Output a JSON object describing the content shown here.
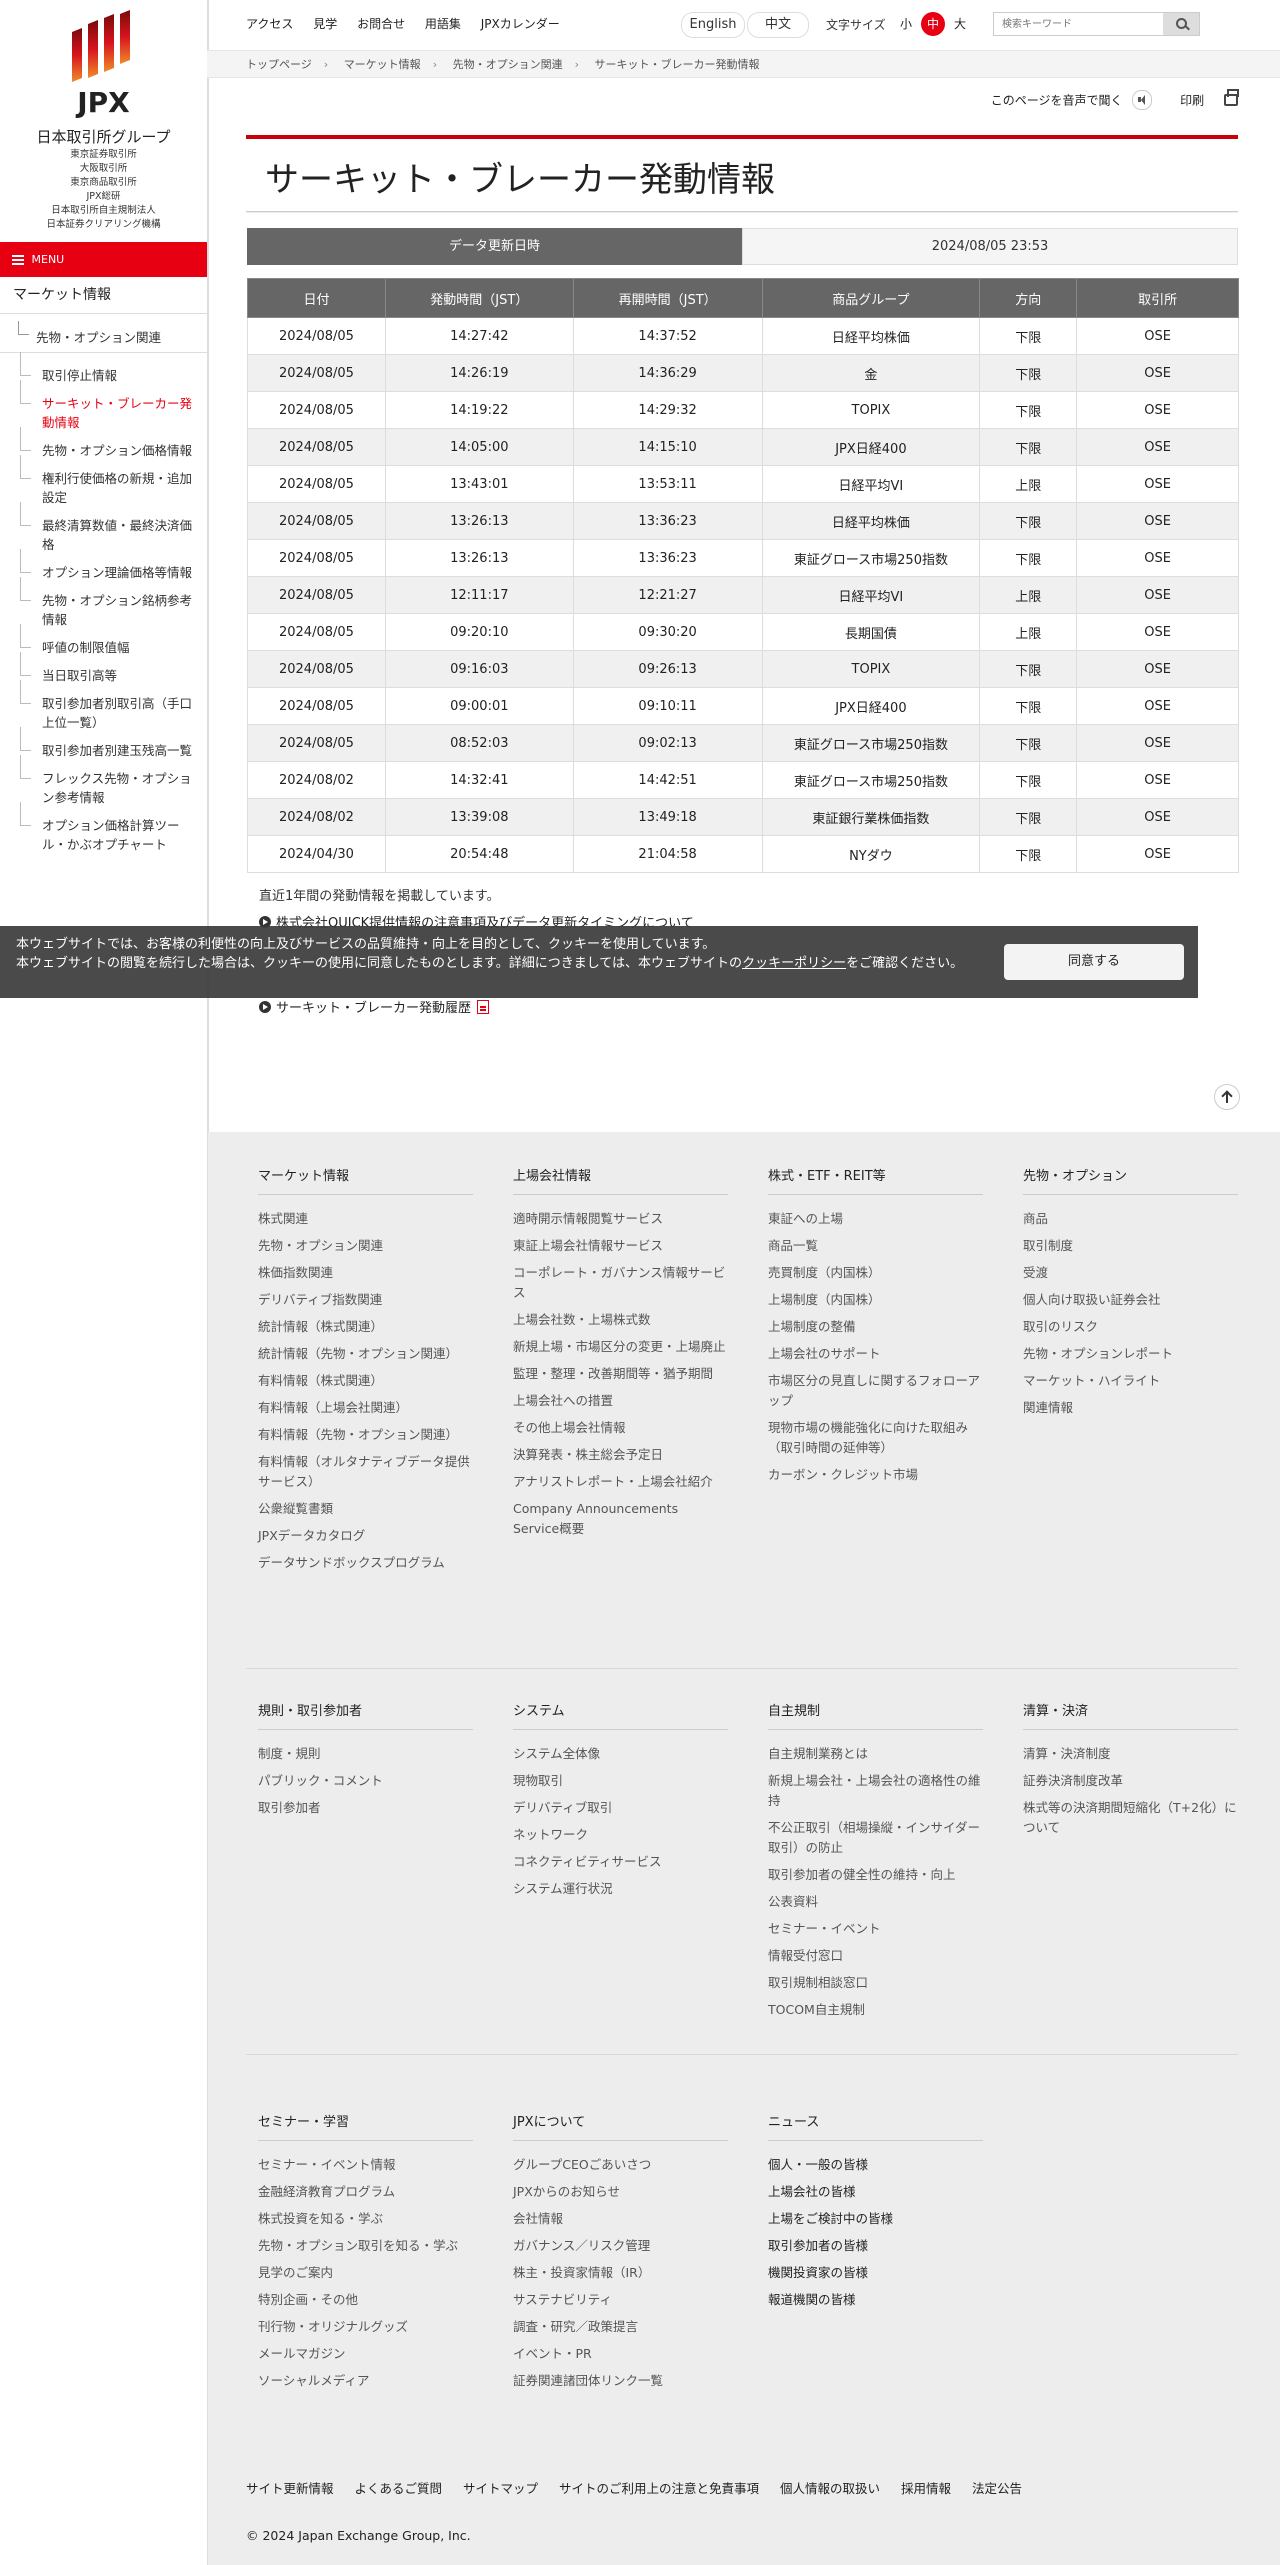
{
  "logo": {
    "brand": "JPX",
    "group_name": "日本取引所グループ",
    "subsidiaries": [
      "東京証券取引所",
      "大阪取引所",
      "東京商品取引所",
      "JPX総研",
      "日本取引所自主規制法人",
      "日本証券クリアリング機構"
    ]
  },
  "menu_label": "MENU",
  "sidebar": {
    "top": "マーケット情報",
    "sub": "先物・オプション関連",
    "items": [
      {
        "label": "取引停止情報",
        "active": false
      },
      {
        "label": "サーキット・ブレーカー発動情報",
        "active": true
      },
      {
        "label": "先物・オプション価格情報",
        "active": false
      },
      {
        "label": "権利行使価格の新規・追加設定",
        "active": false
      },
      {
        "label": "最終清算数値・最終決済価格",
        "active": false
      },
      {
        "label": "オプション理論価格等情報",
        "active": false
      },
      {
        "label": "先物・オプション銘柄参考情報",
        "active": false
      },
      {
        "label": "呼値の制限值幅",
        "active": false
      },
      {
        "label": "当日取引高等",
        "active": false
      },
      {
        "label": "取引参加者別取引高（手口上位一覧）",
        "active": false
      },
      {
        "label": "取引参加者別建玉残高一覧",
        "active": false
      },
      {
        "label": "フレックス先物・オプション参考情報",
        "active": false
      },
      {
        "label": "オプション価格計算ツール・かぶオプチャート",
        "active": false
      }
    ]
  },
  "topnav": [
    "アクセス",
    "見学",
    "お問合せ",
    "用語集",
    "JPXカレンダー"
  ],
  "lang": {
    "english": "English",
    "chinese": "中文"
  },
  "font_size": {
    "label": "文字サイズ",
    "small": "小",
    "medium": "中",
    "large": "大"
  },
  "search": {
    "placeholder": "検索キーワード"
  },
  "breadcrumb": [
    "トップページ",
    "マーケット情報",
    "先物・オプション関連",
    "サーキット・ブレーカー発動情報"
  ],
  "tools": {
    "listen": "このページを音声で聞く",
    "print": "印刷"
  },
  "page_title": "サーキット・ブレーカー発動情報",
  "update": {
    "label": "データ更新日時",
    "value": "2024/08/05 23:53"
  },
  "table": {
    "headers": [
      "日付",
      "発動時間（JST）",
      "再開時間（JST）",
      "商品グループ",
      "方向",
      "取引所"
    ],
    "rows": [
      [
        "2024/08/05",
        "14:27:42",
        "14:37:52",
        "日経平均株価",
        "下限",
        "OSE"
      ],
      [
        "2024/08/05",
        "14:26:19",
        "14:36:29",
        "金",
        "下限",
        "OSE"
      ],
      [
        "2024/08/05",
        "14:19:22",
        "14:29:32",
        "TOPIX",
        "下限",
        "OSE"
      ],
      [
        "2024/08/05",
        "14:05:00",
        "14:15:10",
        "JPX日経400",
        "下限",
        "OSE"
      ],
      [
        "2024/08/05",
        "13:43:01",
        "13:53:11",
        "日経平均VI",
        "上限",
        "OSE"
      ],
      [
        "2024/08/05",
        "13:26:13",
        "13:36:23",
        "日経平均株価",
        "下限",
        "OSE"
      ],
      [
        "2024/08/05",
        "13:26:13",
        "13:36:23",
        "東証グロース市場250指数",
        "下限",
        "OSE"
      ],
      [
        "2024/08/05",
        "12:11:17",
        "12:21:27",
        "日経平均VI",
        "上限",
        "OSE"
      ],
      [
        "2024/08/05",
        "09:20:10",
        "09:30:20",
        "長期国債",
        "上限",
        "OSE"
      ],
      [
        "2024/08/05",
        "09:16:03",
        "09:26:13",
        "TOPIX",
        "下限",
        "OSE"
      ],
      [
        "2024/08/05",
        "09:00:01",
        "09:10:11",
        "JPX日経400",
        "下限",
        "OSE"
      ],
      [
        "2024/08/05",
        "08:52:03",
        "09:02:13",
        "東証グロース市場250指数",
        "下限",
        "OSE"
      ],
      [
        "2024/08/02",
        "14:32:41",
        "14:42:51",
        "東証グロース市場250指数",
        "下限",
        "OSE"
      ],
      [
        "2024/08/02",
        "13:39:08",
        "13:49:18",
        "東証銀行業株価指数",
        "下限",
        "OSE"
      ],
      [
        "2024/04/30",
        "20:54:48",
        "21:04:58",
        "NYダウ",
        "下限",
        "OSE"
      ]
    ]
  },
  "notes": {
    "past_year": "直近1年間の発動情報を掲載しています。",
    "quick_link": "株式会社QUICK提供情報の注意事項及びデータ更新タイミングについて",
    "history_link": "サーキット・ブレーカー発動履歴"
  },
  "cookie": {
    "line1": "本ウェブサイトでは、お客様の利便性の向上及びサービスの品質維持・向上を目的として、クッキーを使用しています。",
    "line2_pre": "本ウェブサイトの閲覧を続行した場合は、クッキーの使用に同意したものとします。詳細につきましては、本ウェブサイトの",
    "policy": "クッキーポリシー",
    "line2_post": "をご確認ください。",
    "agree": "同意する"
  },
  "footer": {
    "market": {
      "head": "マーケット情報",
      "items": [
        "株式関連",
        "先物・オプション関連",
        "株価指数関連",
        "デリバティブ指数関連",
        "統計情報（株式関連）",
        "統計情報（先物・オプション関連）",
        "有料情報（株式関連）",
        "有料情報（上場会社関連）",
        "有料情報（先物・オプション関連）",
        "有料情報（オルタナティブデータ提供サービス）",
        "公衆縦覧書類",
        "JPXデータカタログ",
        "データサンドボックスプログラム"
      ]
    },
    "listed": {
      "head": "上場会社情報",
      "items": [
        "適時開示情報閲覧サービス",
        "東証上場会社情報サービス",
        "コーポレート・ガバナンス情報サービス",
        "上場会社数・上場株式数",
        "新規上場・市場区分の変更・上場廃止",
        "監理・整理・改善期間等・猶予期間",
        "上場会社への措置",
        "その他上場会社情報",
        "決算発表・株主総会予定日",
        "アナリストレポート・上場会社紹介",
        "Company Announcements Service概要"
      ]
    },
    "stocks": {
      "head": "株式・ETF・REIT等",
      "items": [
        "東証への上場",
        "商品一覧",
        "売買制度（内国株）",
        "上場制度（内国株）",
        "上場制度の整備",
        "上場会社のサポート",
        "市場区分の見直しに関するフォローアップ",
        "現物市場の機能強化に向けた取組み（取引時間の延伸等）",
        "カーボン・クレジット市場"
      ]
    },
    "futures": {
      "head": "先物・オプション",
      "items": [
        "商品",
        "取引制度",
        "受渡",
        "個人向け取扱い証券会社",
        "取引のリスク",
        "先物・オプションレポート",
        "マーケット・ハイライト",
        "関連情報"
      ]
    },
    "rules": {
      "head": "規則・取引参加者",
      "items": [
        "制度・規則",
        "パブリック・コメント",
        "取引参加者"
      ]
    },
    "system": {
      "head": "システム",
      "items": [
        "システム全体像",
        "現物取引",
        "デリバティブ取引",
        "ネットワーク",
        "コネクティビティサービス",
        "システム運行状況"
      ]
    },
    "selfreg": {
      "head": "自主規制",
      "items": [
        "自主規制業務とは",
        "新規上場会社・上場会社の適格性の維持",
        "不公正取引（相場操縦・インサイダー取引）の防止",
        "取引参加者の健全性の維持・向上",
        "公表資料",
        "セミナー・イベント",
        "情報受付窓口",
        "取引規制相談窓口",
        "TOCOM自主規制"
      ]
    },
    "clearing": {
      "head": "清算・決済",
      "items": [
        "清算・決済制度",
        "証券決済制度改革",
        "株式等の決済期間短縮化（T+2化）について"
      ]
    },
    "seminar": {
      "head": "セミナー・学習",
      "items": [
        "セミナー・イベント情報",
        "金融経済教育プログラム",
        "株式投資を知る・学ぶ",
        "先物・オプション取引を知る・学ぶ",
        "見学のご案内",
        "特別企画・その他",
        "刊行物・オリジナルグッズ",
        "メールマガジン",
        "ソーシャルメディア"
      ]
    },
    "about": {
      "head": "JPXについて",
      "items": [
        "グループCEOごあいさつ",
        "JPXからのお知らせ",
        "会社情報",
        "ガバナンス／リスク管理",
        "株主・投資家情報（IR）",
        "サステナビリティ",
        "調査・研究／政策提言",
        "イベント・PR",
        "証券関連諸団体リンク一覧"
      ]
    },
    "news": {
      "head": "ニュース",
      "items": [
        "個人・一般の皆様",
        "上場会社の皆様",
        "上場をご検討中の皆様",
        "取引参加者の皆様",
        "機関投資家の皆様",
        "報道機関の皆様"
      ]
    },
    "bottom_links": [
      "サイト更新情報",
      "よくあるご質問",
      "サイトマップ",
      "サイトのご利用上の注意と免責事項",
      "個人情報の取扱い",
      "採用情報",
      "法定公告"
    ],
    "copyright": "© 2024 Japan Exchange Group, Inc."
  },
  "colors": {
    "brand_red": "#e60012",
    "header_gray": "#666666",
    "footer_bg": "#ededed"
  }
}
